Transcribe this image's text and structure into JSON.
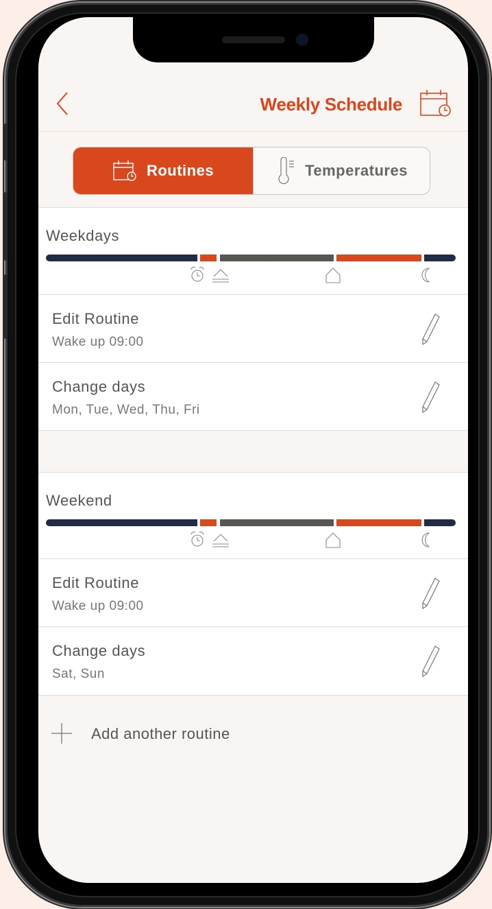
{
  "header": {
    "title": "Weekly Schedule",
    "back_icon": "chevron-left-icon",
    "calendar_icon": "calendar-clock-icon"
  },
  "tabs": [
    {
      "label": "Routines",
      "icon": "calendar-clock-icon",
      "active": true
    },
    {
      "label": "Temperatures",
      "icon": "thermometer-icon",
      "active": false
    }
  ],
  "weekdays": {
    "title": "Weekdays",
    "edit_title": "Edit Routine",
    "edit_sub": "Wake up 09:00",
    "days_title": "Change days",
    "days_sub": "Mon, Tue, Wed, Thu, Fri"
  },
  "weekend": {
    "title": "Weekend",
    "edit_title": "Edit Routine",
    "edit_sub": "Wake up 09:00",
    "days_title": "Change days",
    "days_sub": "Sat, Sun"
  },
  "add_routine": {
    "label": "Add another routine"
  },
  "colors": {
    "accent": "#d9481c",
    "navy": "#232a45",
    "gray": "#555752",
    "background": "#f9f5f2"
  },
  "timeline_icons": [
    "alarm-clock-icon",
    "sunrise-icon",
    "home-icon",
    "moon-icon"
  ]
}
